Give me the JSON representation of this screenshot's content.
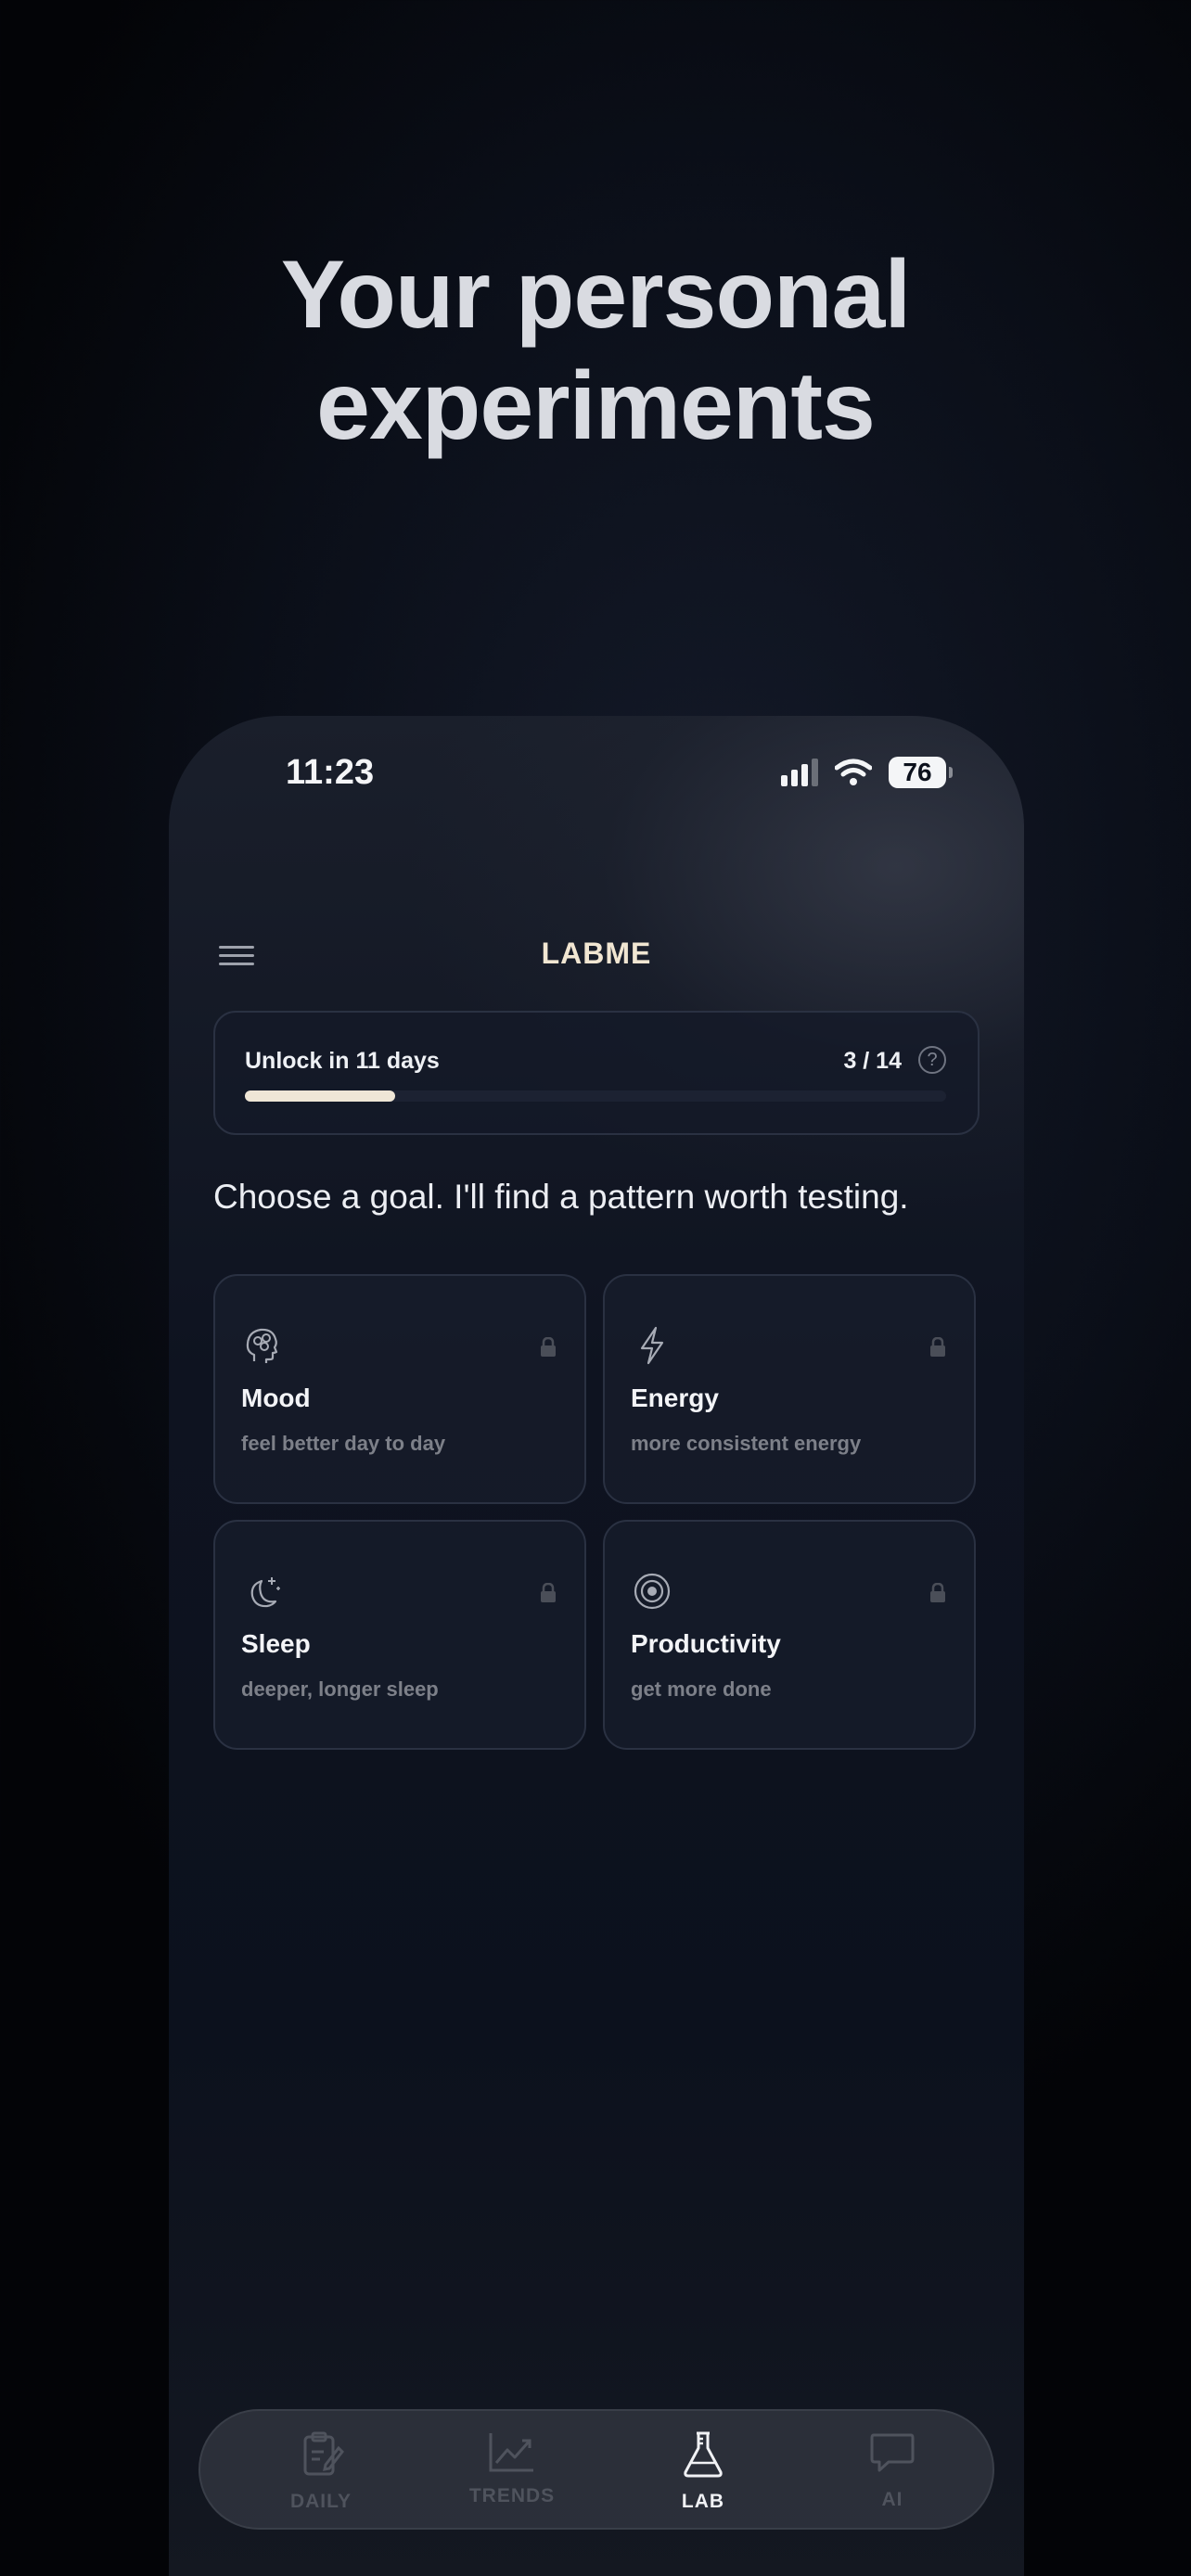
{
  "headline": {
    "line1": "Your personal",
    "line2": "experiments"
  },
  "status_bar": {
    "time": "11:23",
    "battery": "76"
  },
  "app": {
    "title": "LABME"
  },
  "unlock": {
    "label": "Unlock in 11 days",
    "count": "3 / 14",
    "progress": 0.214
  },
  "prompt": "Choose a goal. I'll find a pattern worth testing.",
  "goals": [
    {
      "name": "Mood",
      "desc": "feel better day to day",
      "icon": "brain-icon",
      "locked": true
    },
    {
      "name": "Energy",
      "desc": "more consistent energy",
      "icon": "lightning-icon",
      "locked": true
    },
    {
      "name": "Sleep",
      "desc": "deeper, longer sleep",
      "icon": "moon-stars-icon",
      "locked": true
    },
    {
      "name": "Productivity",
      "desc": "get more done",
      "icon": "target-icon",
      "locked": true
    }
  ],
  "tabs": [
    {
      "label": "DAILY",
      "icon": "clipboard-edit-icon",
      "active": false
    },
    {
      "label": "TRENDS",
      "icon": "chart-line-icon",
      "active": false
    },
    {
      "label": "LAB",
      "icon": "flask-icon",
      "active": true
    },
    {
      "label": "AI",
      "icon": "chat-bubble-icon",
      "active": false
    }
  ],
  "colors": {
    "accent": "#efe6d6",
    "background": "#0b0f19",
    "card": "#161c2a"
  }
}
